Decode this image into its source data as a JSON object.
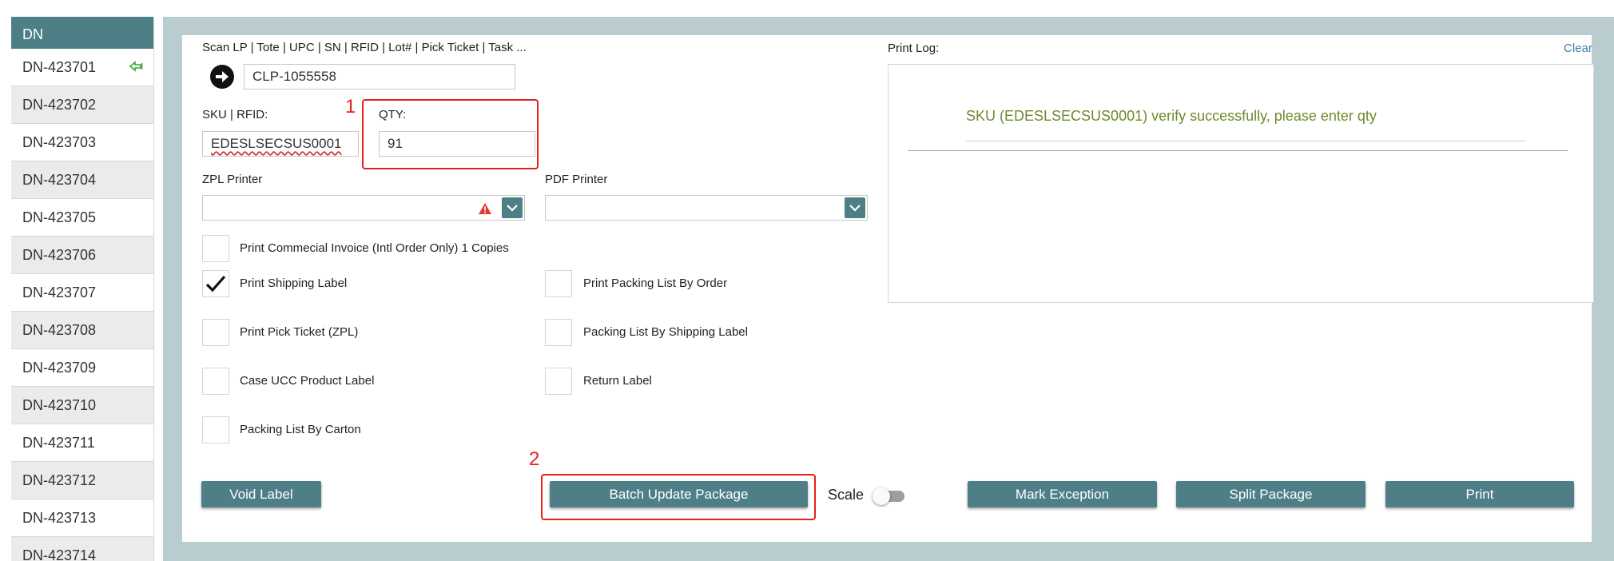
{
  "sidebar": {
    "header": "DN",
    "items": [
      {
        "label": "DN-423701",
        "pinned": true
      },
      {
        "label": "DN-423702"
      },
      {
        "label": "DN-423703"
      },
      {
        "label": "DN-423704"
      },
      {
        "label": "DN-423705"
      },
      {
        "label": "DN-423706"
      },
      {
        "label": "DN-423707"
      },
      {
        "label": "DN-423708"
      },
      {
        "label": "DN-423709"
      },
      {
        "label": "DN-423710"
      },
      {
        "label": "DN-423711"
      },
      {
        "label": "DN-423712"
      },
      {
        "label": "DN-423713"
      },
      {
        "label": "DN-423714"
      }
    ]
  },
  "scan": {
    "label": "Scan LP | Tote | UPC | SN | RFID | Lot# | Pick Ticket | Task ...",
    "value": "CLP-1055558"
  },
  "sku": {
    "label": "SKU | RFID:",
    "value": "EDESLSECSUS0001"
  },
  "qty": {
    "label": "QTY:",
    "value": "91"
  },
  "markers": {
    "one": "1",
    "two": "2"
  },
  "zpl": {
    "label": "ZPL Printer",
    "value": ""
  },
  "pdf": {
    "label": "PDF Printer",
    "value": ""
  },
  "options": {
    "commercial_invoice": {
      "label": "Print Commecial Invoice (Intl Order Only) 1 Copies",
      "checked": false
    },
    "shipping_label": {
      "label": "Print Shipping Label",
      "checked": true
    },
    "packing_list_order": {
      "label": "Print Packing List By Order",
      "checked": false
    },
    "pick_ticket": {
      "label": "Print Pick Ticket (ZPL)",
      "checked": false
    },
    "packing_list_shipping": {
      "label": "Packing List By Shipping Label",
      "checked": false
    },
    "case_ucc": {
      "label": "Case UCC Product Label",
      "checked": false
    },
    "return_label": {
      "label": "Return Label",
      "checked": false
    },
    "packing_list_carton": {
      "label": "Packing List By Carton",
      "checked": false
    }
  },
  "log": {
    "label": "Print Log:",
    "clear": "Clear",
    "message": "SKU (EDESLSECSUS0001) verify successfully, please enter qty"
  },
  "buttons": {
    "void_label": "Void Label",
    "batch_update": "Batch Update Package",
    "scale": "Scale",
    "scale_on": false,
    "mark_exception": "Mark Exception",
    "split_package": "Split Package",
    "print": "Print"
  },
  "colors": {
    "accent": "#4f7f86",
    "frame": "#b9cdd1",
    "success_text": "#6e8a2c",
    "annotation_red": "#e8201a",
    "warning_red": "#e53935"
  }
}
